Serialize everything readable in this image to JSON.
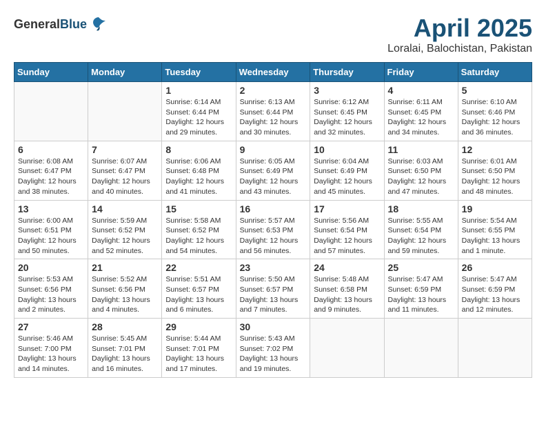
{
  "header": {
    "logo_general": "General",
    "logo_blue": "Blue",
    "month": "April 2025",
    "location": "Loralai, Balochistan, Pakistan"
  },
  "weekdays": [
    "Sunday",
    "Monday",
    "Tuesday",
    "Wednesday",
    "Thursday",
    "Friday",
    "Saturday"
  ],
  "weeks": [
    [
      {
        "day": "",
        "content": ""
      },
      {
        "day": "",
        "content": ""
      },
      {
        "day": "1",
        "content": "Sunrise: 6:14 AM\nSunset: 6:44 PM\nDaylight: 12 hours and 29 minutes."
      },
      {
        "day": "2",
        "content": "Sunrise: 6:13 AM\nSunset: 6:44 PM\nDaylight: 12 hours and 30 minutes."
      },
      {
        "day": "3",
        "content": "Sunrise: 6:12 AM\nSunset: 6:45 PM\nDaylight: 12 hours and 32 minutes."
      },
      {
        "day": "4",
        "content": "Sunrise: 6:11 AM\nSunset: 6:45 PM\nDaylight: 12 hours and 34 minutes."
      },
      {
        "day": "5",
        "content": "Sunrise: 6:10 AM\nSunset: 6:46 PM\nDaylight: 12 hours and 36 minutes."
      }
    ],
    [
      {
        "day": "6",
        "content": "Sunrise: 6:08 AM\nSunset: 6:47 PM\nDaylight: 12 hours and 38 minutes."
      },
      {
        "day": "7",
        "content": "Sunrise: 6:07 AM\nSunset: 6:47 PM\nDaylight: 12 hours and 40 minutes."
      },
      {
        "day": "8",
        "content": "Sunrise: 6:06 AM\nSunset: 6:48 PM\nDaylight: 12 hours and 41 minutes."
      },
      {
        "day": "9",
        "content": "Sunrise: 6:05 AM\nSunset: 6:49 PM\nDaylight: 12 hours and 43 minutes."
      },
      {
        "day": "10",
        "content": "Sunrise: 6:04 AM\nSunset: 6:49 PM\nDaylight: 12 hours and 45 minutes."
      },
      {
        "day": "11",
        "content": "Sunrise: 6:03 AM\nSunset: 6:50 PM\nDaylight: 12 hours and 47 minutes."
      },
      {
        "day": "12",
        "content": "Sunrise: 6:01 AM\nSunset: 6:50 PM\nDaylight: 12 hours and 48 minutes."
      }
    ],
    [
      {
        "day": "13",
        "content": "Sunrise: 6:00 AM\nSunset: 6:51 PM\nDaylight: 12 hours and 50 minutes."
      },
      {
        "day": "14",
        "content": "Sunrise: 5:59 AM\nSunset: 6:52 PM\nDaylight: 12 hours and 52 minutes."
      },
      {
        "day": "15",
        "content": "Sunrise: 5:58 AM\nSunset: 6:52 PM\nDaylight: 12 hours and 54 minutes."
      },
      {
        "day": "16",
        "content": "Sunrise: 5:57 AM\nSunset: 6:53 PM\nDaylight: 12 hours and 56 minutes."
      },
      {
        "day": "17",
        "content": "Sunrise: 5:56 AM\nSunset: 6:54 PM\nDaylight: 12 hours and 57 minutes."
      },
      {
        "day": "18",
        "content": "Sunrise: 5:55 AM\nSunset: 6:54 PM\nDaylight: 12 hours and 59 minutes."
      },
      {
        "day": "19",
        "content": "Sunrise: 5:54 AM\nSunset: 6:55 PM\nDaylight: 13 hours and 1 minute."
      }
    ],
    [
      {
        "day": "20",
        "content": "Sunrise: 5:53 AM\nSunset: 6:56 PM\nDaylight: 13 hours and 2 minutes."
      },
      {
        "day": "21",
        "content": "Sunrise: 5:52 AM\nSunset: 6:56 PM\nDaylight: 13 hours and 4 minutes."
      },
      {
        "day": "22",
        "content": "Sunrise: 5:51 AM\nSunset: 6:57 PM\nDaylight: 13 hours and 6 minutes."
      },
      {
        "day": "23",
        "content": "Sunrise: 5:50 AM\nSunset: 6:57 PM\nDaylight: 13 hours and 7 minutes."
      },
      {
        "day": "24",
        "content": "Sunrise: 5:48 AM\nSunset: 6:58 PM\nDaylight: 13 hours and 9 minutes."
      },
      {
        "day": "25",
        "content": "Sunrise: 5:47 AM\nSunset: 6:59 PM\nDaylight: 13 hours and 11 minutes."
      },
      {
        "day": "26",
        "content": "Sunrise: 5:47 AM\nSunset: 6:59 PM\nDaylight: 13 hours and 12 minutes."
      }
    ],
    [
      {
        "day": "27",
        "content": "Sunrise: 5:46 AM\nSunset: 7:00 PM\nDaylight: 13 hours and 14 minutes."
      },
      {
        "day": "28",
        "content": "Sunrise: 5:45 AM\nSunset: 7:01 PM\nDaylight: 13 hours and 16 minutes."
      },
      {
        "day": "29",
        "content": "Sunrise: 5:44 AM\nSunset: 7:01 PM\nDaylight: 13 hours and 17 minutes."
      },
      {
        "day": "30",
        "content": "Sunrise: 5:43 AM\nSunset: 7:02 PM\nDaylight: 13 hours and 19 minutes."
      },
      {
        "day": "",
        "content": ""
      },
      {
        "day": "",
        "content": ""
      },
      {
        "day": "",
        "content": ""
      }
    ]
  ]
}
